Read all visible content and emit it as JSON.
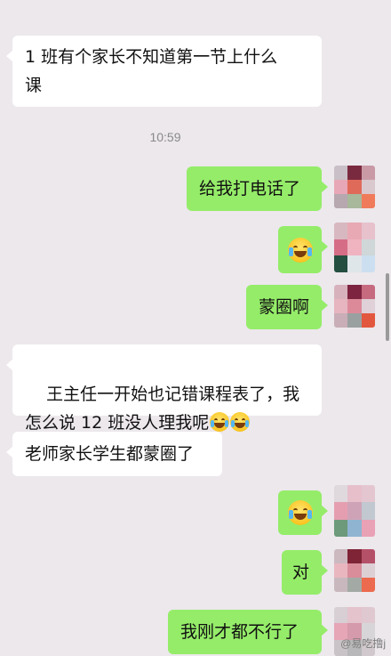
{
  "messages": [
    {
      "side": "left",
      "text": "1 班有个家长不知道第一节上什么\n课"
    },
    {
      "type": "time",
      "text": "10:59"
    },
    {
      "side": "right",
      "text": "给我打电话了"
    },
    {
      "side": "right",
      "emoji": "laugh-cry-emoji"
    },
    {
      "side": "right",
      "text": "蒙圈啊"
    },
    {
      "side": "left",
      "text": "王主任一开始也记错课程表了，我\n怎么说 12 班没人理我呢",
      "emojis_after": 2
    },
    {
      "side": "left",
      "text": "老师家长学生都蒙圈了"
    },
    {
      "side": "right",
      "emoji": "laugh-cry-emoji"
    },
    {
      "side": "right",
      "text": "对"
    },
    {
      "side": "right",
      "text": "我刚才都不行了"
    }
  ],
  "watermark": "@易吃撸j",
  "colors": {
    "background": "#ece8ec",
    "left_bubble": "#ffffff",
    "right_bubble": "#95ec69"
  }
}
